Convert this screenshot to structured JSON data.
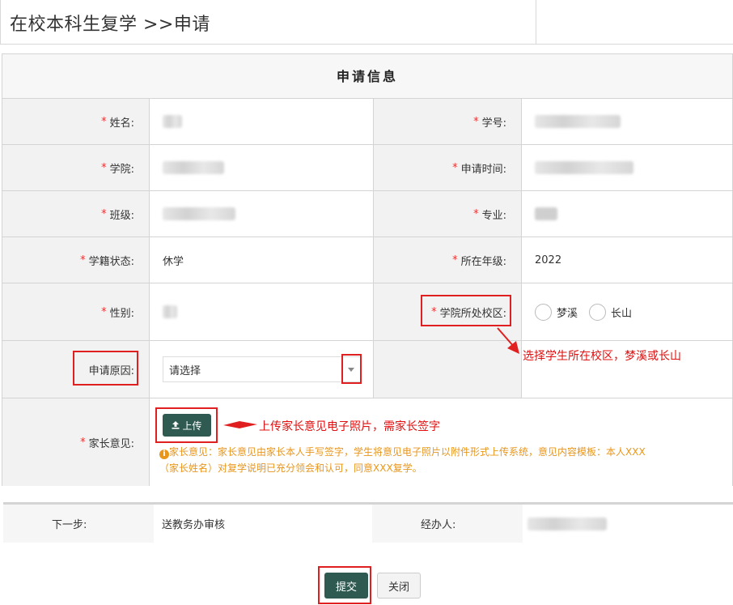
{
  "page": {
    "title": "在校本科生复学 >>申请"
  },
  "form": {
    "section_title": "申请信息",
    "required_mark": "*",
    "fields": {
      "name": {
        "label": "姓名:"
      },
      "student_id": {
        "label": "学号:"
      },
      "college": {
        "label": "学院:"
      },
      "apply_time": {
        "label": "申请时间:"
      },
      "class": {
        "label": "班级:"
      },
      "major": {
        "label": "专业:"
      },
      "status": {
        "label": "学籍状态:",
        "value": "休学"
      },
      "grade": {
        "label": "所在年级:",
        "value": "2022"
      },
      "gender": {
        "label": "性别:"
      },
      "campus": {
        "label": "学院所处校区:",
        "options": [
          "梦溪",
          "长山"
        ]
      },
      "reason": {
        "label": "申请原因:",
        "placeholder": "请选择"
      },
      "parent": {
        "label": "家长意见:",
        "upload_label": "上传",
        "note_line1": "家长意见：家长意见由家长本人手写签字，学生将意见电子照片以附件形式上传系统，意见内容模板：本人XXX",
        "note_line2": "（家长姓名）对复学说明已充分领会和认可，同意XXX复学。"
      }
    }
  },
  "annotations": {
    "campus_hint": "选择学生所在校区，梦溪或长山",
    "upload_hint": "上传家长意见电子照片，需家长签字"
  },
  "workflow": {
    "next_step_label": "下一步:",
    "next_step_value": "送教务办审核",
    "handler_label": "经办人:"
  },
  "actions": {
    "submit": "提交",
    "close": "关闭"
  },
  "colors": {
    "accent": "#2e5a52",
    "required": "#e33333",
    "annotation": "#e01010",
    "note": "#e8961c"
  }
}
